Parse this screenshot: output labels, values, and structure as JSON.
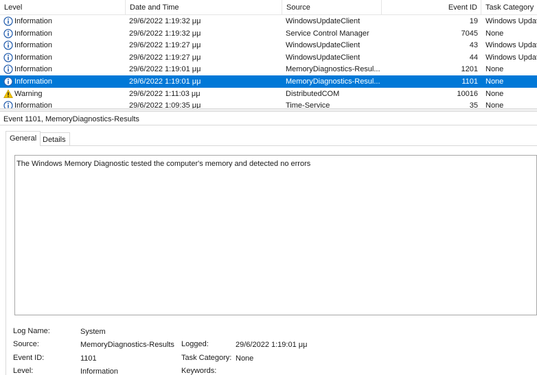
{
  "columns": {
    "level": "Level",
    "date_time": "Date and Time",
    "source": "Source",
    "event_id": "Event ID",
    "task_category": "Task Category"
  },
  "rows": [
    {
      "level": "Information",
      "icon": "info-icon",
      "date_time": "29/6/2022 1:19:32 μμ",
      "source": "WindowsUpdateClient",
      "event_id": "19",
      "task_category": "Windows Update Agent",
      "selected": false
    },
    {
      "level": "Information",
      "icon": "info-icon",
      "date_time": "29/6/2022 1:19:32 μμ",
      "source": "Service Control Manager",
      "event_id": "7045",
      "task_category": "None",
      "selected": false
    },
    {
      "level": "Information",
      "icon": "info-icon",
      "date_time": "29/6/2022 1:19:27 μμ",
      "source": "WindowsUpdateClient",
      "event_id": "43",
      "task_category": "Windows Update Agent",
      "selected": false
    },
    {
      "level": "Information",
      "icon": "info-icon",
      "date_time": "29/6/2022 1:19:27 μμ",
      "source": "WindowsUpdateClient",
      "event_id": "44",
      "task_category": "Windows Update Agent",
      "selected": false
    },
    {
      "level": "Information",
      "icon": "info-icon",
      "date_time": "29/6/2022 1:19:01 μμ",
      "source": "MemoryDiagnostics-Resul...",
      "event_id": "1201",
      "task_category": "None",
      "selected": false
    },
    {
      "level": "Information",
      "icon": "info-icon",
      "date_time": "29/6/2022 1:19:01 μμ",
      "source": "MemoryDiagnostics-Resul...",
      "event_id": "1101",
      "task_category": "None",
      "selected": true
    },
    {
      "level": "Warning",
      "icon": "warning-icon",
      "date_time": "29/6/2022 1:11:03 μμ",
      "source": "DistributedCOM",
      "event_id": "10016",
      "task_category": "None",
      "selected": false
    },
    {
      "level": "Information",
      "icon": "info-icon",
      "date_time": "29/6/2022 1:09:35 μμ",
      "source": "Time-Service",
      "event_id": "35",
      "task_category": "None",
      "selected": false
    }
  ],
  "detail": {
    "title": "Event 1101, MemoryDiagnostics-Results",
    "tabs": [
      {
        "label": "General",
        "active": true
      },
      {
        "label": "Details",
        "active": false
      }
    ],
    "description": "The Windows Memory Diagnostic tested the computer's memory and detected no errors",
    "properties": {
      "log_name_label": "Log Name:",
      "log_name_value": "System",
      "source_label": "Source:",
      "source_value": "MemoryDiagnostics-Results",
      "logged_label": "Logged:",
      "logged_value": "29/6/2022 1:19:01 μμ",
      "event_id_label": "Event ID:",
      "event_id_value": "1101",
      "task_category_label": "Task Category:",
      "task_category_value": "None",
      "level_label": "Level:",
      "level_value": "Information",
      "keywords_label": "Keywords:"
    }
  },
  "colors": {
    "selection": "#0078d7",
    "info_icon": "#2b63b0",
    "warning_icon": "#f2c200"
  }
}
